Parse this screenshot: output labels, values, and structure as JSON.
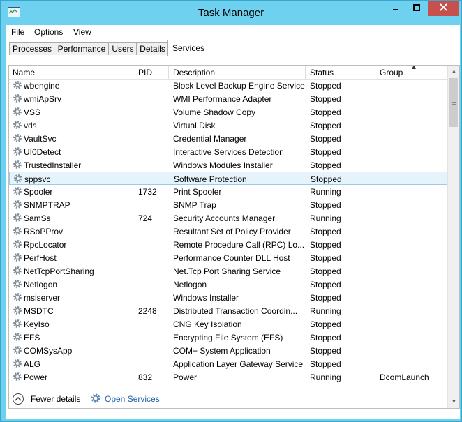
{
  "window": {
    "title": "Task Manager",
    "controls": [
      "minimize",
      "maximize",
      "close"
    ]
  },
  "menu": [
    "File",
    "Options",
    "View"
  ],
  "tabs": [
    {
      "label": "Processes",
      "active": false
    },
    {
      "label": "Performance",
      "active": false
    },
    {
      "label": "Users",
      "active": false
    },
    {
      "label": "Details",
      "active": false
    },
    {
      "label": "Services",
      "active": true
    }
  ],
  "columns": {
    "name": "Name",
    "pid": "PID",
    "description": "Description",
    "status": "Status",
    "group": "Group",
    "sort_column": "Group",
    "sort_direction": "ascending"
  },
  "services": [
    {
      "name": "wbengine",
      "pid": "",
      "description": "Block Level Backup Engine Service",
      "status": "Stopped",
      "group": ""
    },
    {
      "name": "wmiApSrv",
      "pid": "",
      "description": "WMI Performance Adapter",
      "status": "Stopped",
      "group": ""
    },
    {
      "name": "VSS",
      "pid": "",
      "description": "Volume Shadow Copy",
      "status": "Stopped",
      "group": ""
    },
    {
      "name": "vds",
      "pid": "",
      "description": "Virtual Disk",
      "status": "Stopped",
      "group": ""
    },
    {
      "name": "VaultSvc",
      "pid": "",
      "description": "Credential Manager",
      "status": "Stopped",
      "group": ""
    },
    {
      "name": "UI0Detect",
      "pid": "",
      "description": "Interactive Services Detection",
      "status": "Stopped",
      "group": ""
    },
    {
      "name": "TrustedInstaller",
      "pid": "",
      "description": "Windows Modules Installer",
      "status": "Stopped",
      "group": ""
    },
    {
      "name": "sppsvc",
      "pid": "",
      "description": "Software Protection",
      "status": "Stopped",
      "group": "",
      "selected": true
    },
    {
      "name": "Spooler",
      "pid": "1732",
      "description": "Print Spooler",
      "status": "Running",
      "group": ""
    },
    {
      "name": "SNMPTRAP",
      "pid": "",
      "description": "SNMP Trap",
      "status": "Stopped",
      "group": ""
    },
    {
      "name": "SamSs",
      "pid": "724",
      "description": "Security Accounts Manager",
      "status": "Running",
      "group": ""
    },
    {
      "name": "RSoPProv",
      "pid": "",
      "description": "Resultant Set of Policy Provider",
      "status": "Stopped",
      "group": ""
    },
    {
      "name": "RpcLocator",
      "pid": "",
      "description": "Remote Procedure Call (RPC) Lo...",
      "status": "Stopped",
      "group": ""
    },
    {
      "name": "PerfHost",
      "pid": "",
      "description": "Performance Counter DLL Host",
      "status": "Stopped",
      "group": ""
    },
    {
      "name": "NetTcpPortSharing",
      "pid": "",
      "description": "Net.Tcp Port Sharing Service",
      "status": "Stopped",
      "group": ""
    },
    {
      "name": "Netlogon",
      "pid": "",
      "description": "Netlogon",
      "status": "Stopped",
      "group": ""
    },
    {
      "name": "msiserver",
      "pid": "",
      "description": "Windows Installer",
      "status": "Stopped",
      "group": ""
    },
    {
      "name": "MSDTC",
      "pid": "2248",
      "description": "Distributed Transaction Coordin...",
      "status": "Running",
      "group": ""
    },
    {
      "name": "KeyIso",
      "pid": "",
      "description": "CNG Key Isolation",
      "status": "Stopped",
      "group": ""
    },
    {
      "name": "EFS",
      "pid": "",
      "description": "Encrypting File System (EFS)",
      "status": "Stopped",
      "group": ""
    },
    {
      "name": "COMSysApp",
      "pid": "",
      "description": "COM+ System Application",
      "status": "Stopped",
      "group": ""
    },
    {
      "name": "ALG",
      "pid": "",
      "description": "Application Layer Gateway Service",
      "status": "Stopped",
      "group": ""
    },
    {
      "name": "Power",
      "pid": "832",
      "description": "Power",
      "status": "Running",
      "group": "DcomLaunch"
    }
  ],
  "footer": {
    "fewer_details": "Fewer details",
    "open_services": "Open Services"
  },
  "colors": {
    "frame": "#6fd1f0",
    "close_button": "#c7504d",
    "selection_bg": "#e5f3fb",
    "selection_border": "#99c9ec",
    "link": "#1e5fa8",
    "service_icon": "#7d8a96"
  }
}
